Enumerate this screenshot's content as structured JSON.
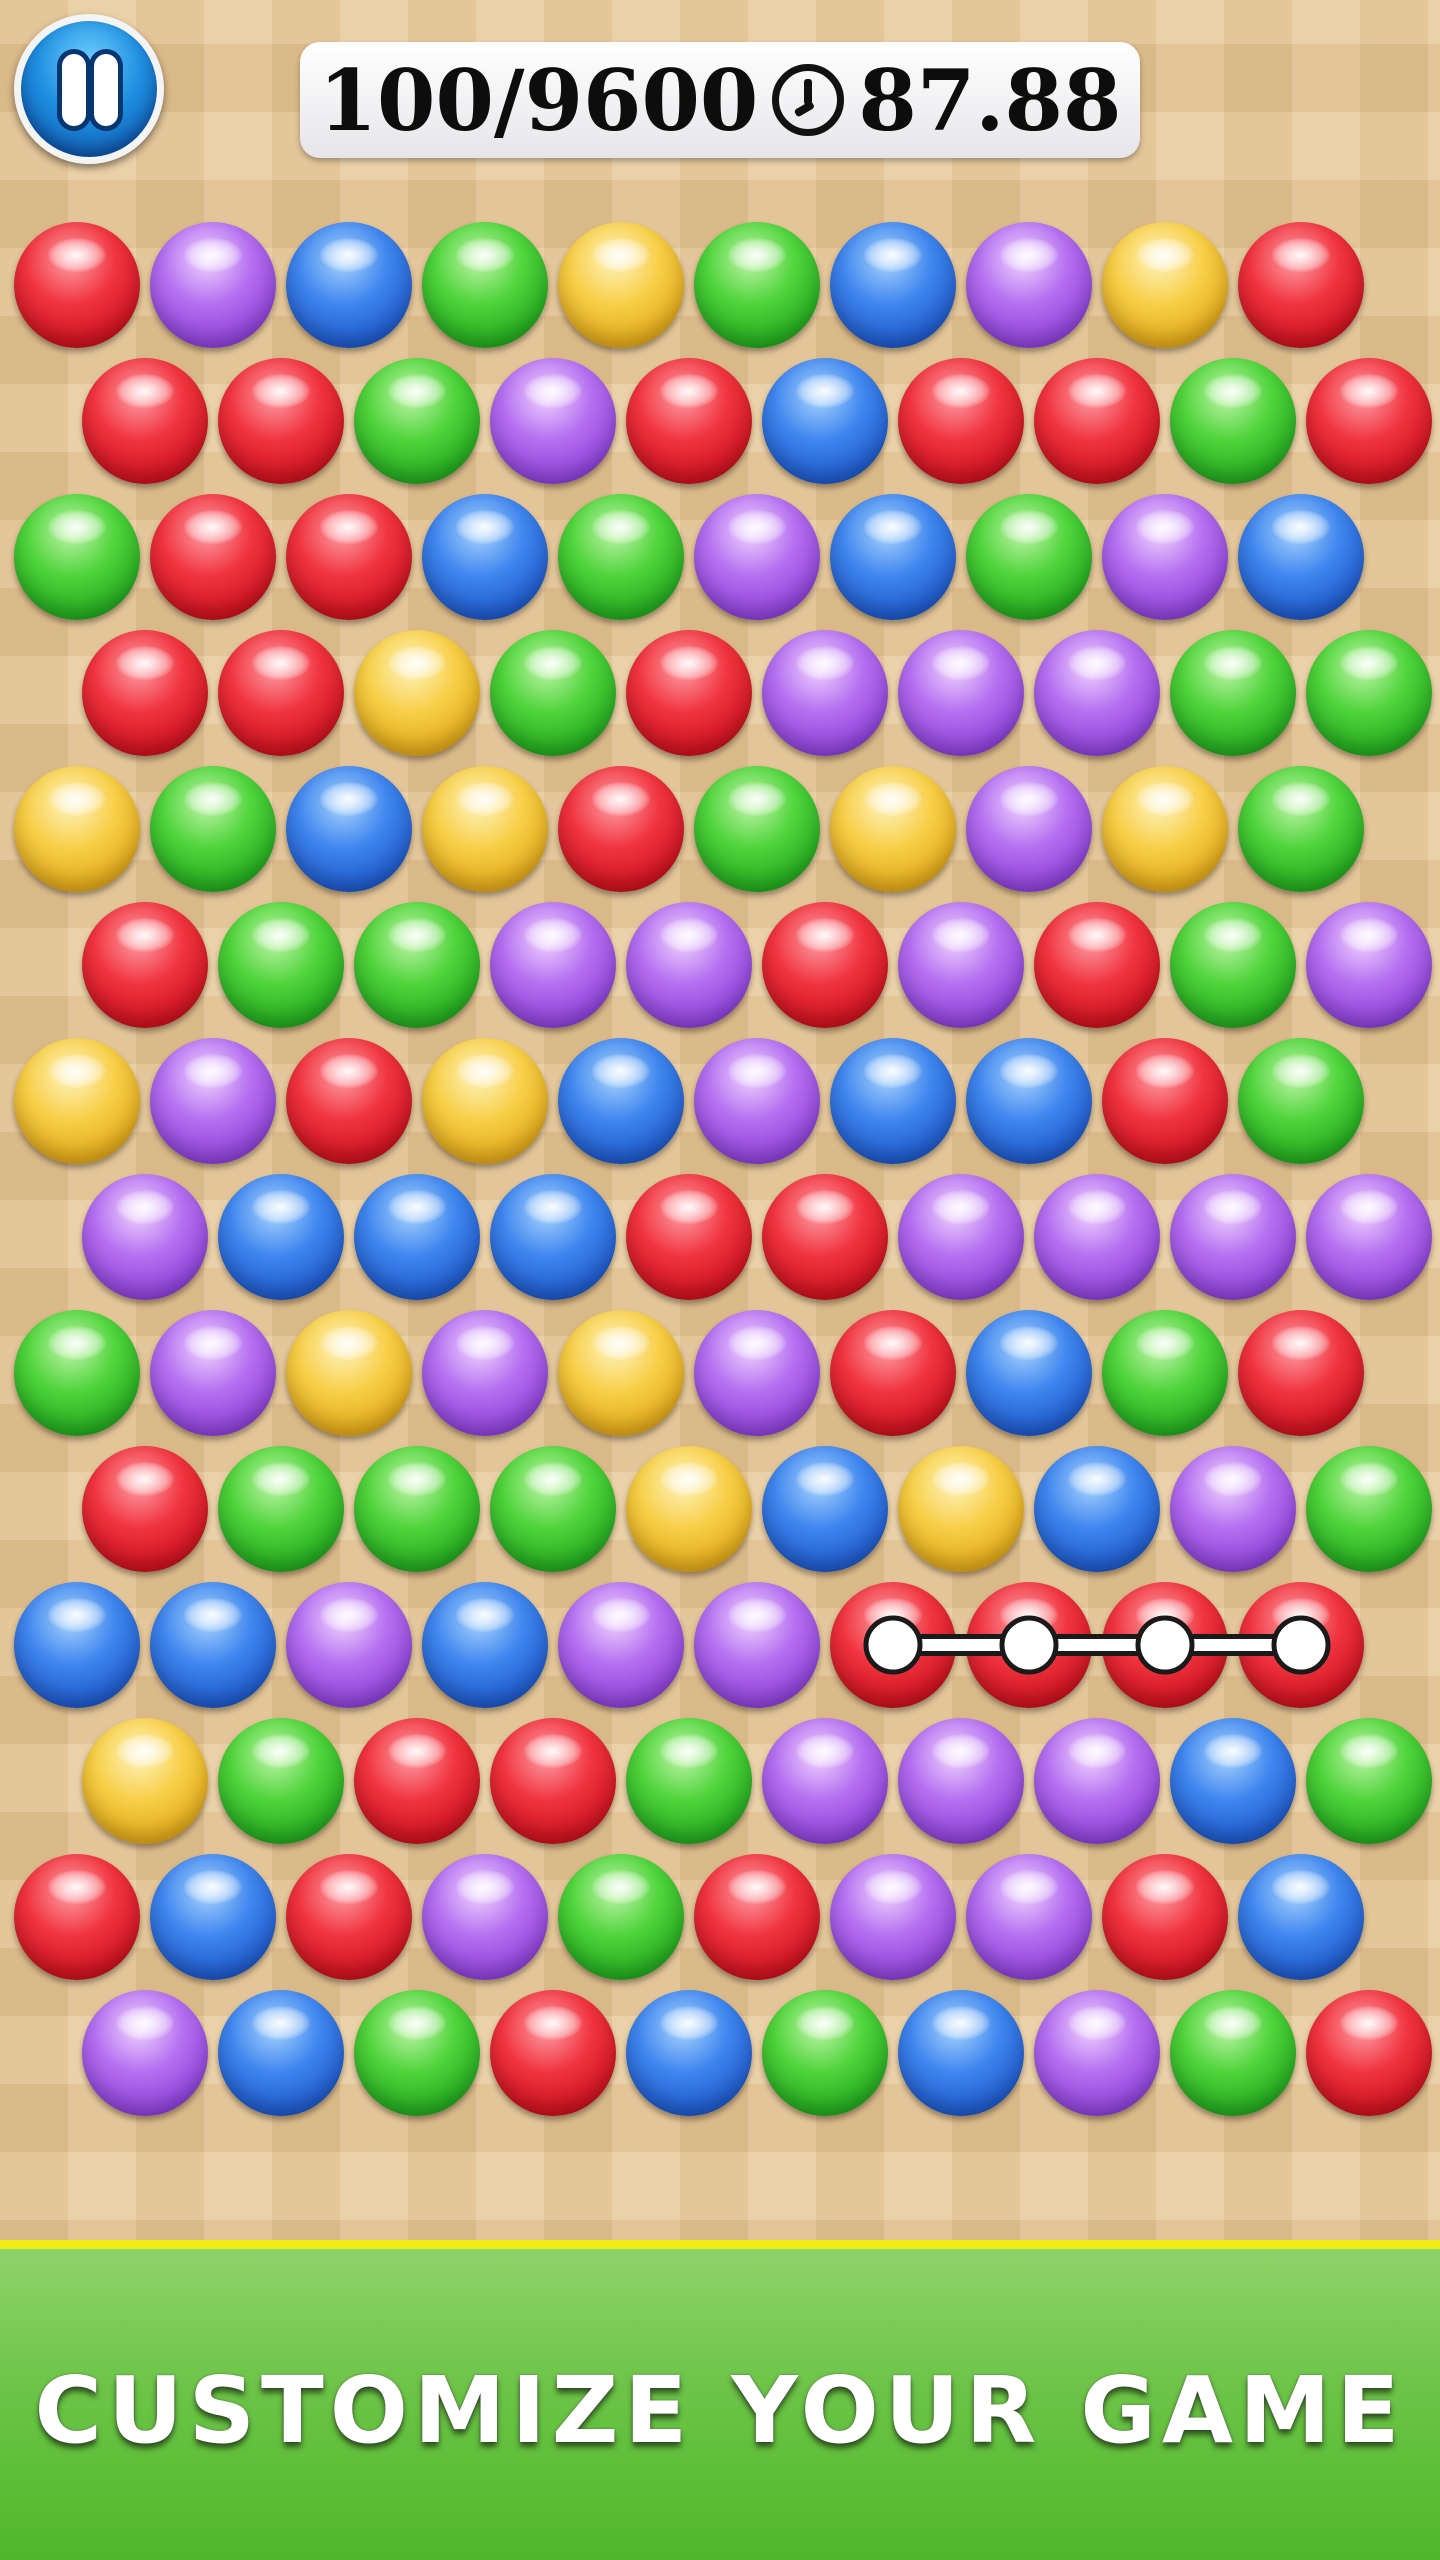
{
  "hud": {
    "pause_icon": "pause-icon",
    "score": "100/9600",
    "clock_icon": "clock-icon",
    "time_left": "87.88"
  },
  "colors": {
    "red": "#e02a35",
    "purple": "#a25ce8",
    "blue": "#2f6fe0",
    "green": "#3cc42f",
    "yellow": "#f0c230",
    "banner": "#5cbf35",
    "banner_border": "#f0ea15"
  },
  "board": {
    "rows": [
      [
        "red",
        "purple",
        "blue",
        "green",
        "yellow",
        "green",
        "blue",
        "purple",
        "yellow",
        "red"
      ],
      [
        "red",
        "red",
        "green",
        "purple",
        "red",
        "blue",
        "red",
        "red",
        "green",
        "red"
      ],
      [
        "green",
        "red",
        "red",
        "blue",
        "green",
        "purple",
        "blue",
        "green",
        "purple",
        "blue"
      ],
      [
        "red",
        "red",
        "yellow",
        "green",
        "red",
        "purple",
        "purple",
        "purple",
        "green",
        "green"
      ],
      [
        "yellow",
        "green",
        "blue",
        "yellow",
        "red",
        "green",
        "yellow",
        "purple",
        "yellow",
        "green"
      ],
      [
        "red",
        "green",
        "green",
        "purple",
        "purple",
        "red",
        "purple",
        "red",
        "green",
        "purple"
      ],
      [
        "yellow",
        "purple",
        "red",
        "yellow",
        "blue",
        "purple",
        "blue",
        "blue",
        "red",
        "green"
      ],
      [
        "purple",
        "blue",
        "blue",
        "blue",
        "red",
        "red",
        "purple",
        "purple",
        "purple",
        "purple"
      ],
      [
        "green",
        "purple",
        "yellow",
        "purple",
        "yellow",
        "purple",
        "red",
        "blue",
        "green",
        "red"
      ],
      [
        "red",
        "green",
        "green",
        "green",
        "yellow",
        "blue",
        "yellow",
        "blue",
        "purple",
        "green"
      ],
      [
        "blue",
        "blue",
        "purple",
        "blue",
        "purple",
        "purple",
        "red",
        "red",
        "red",
        "red"
      ],
      [
        "yellow",
        "green",
        "red",
        "red",
        "green",
        "purple",
        "purple",
        "purple",
        "blue",
        "green"
      ],
      [
        "red",
        "blue",
        "red",
        "purple",
        "green",
        "red",
        "purple",
        "purple",
        "red",
        "blue"
      ],
      [
        "purple",
        "blue",
        "green",
        "red",
        "blue",
        "green",
        "blue",
        "purple",
        "green",
        "red"
      ]
    ],
    "selected_path": [
      [
        10,
        6
      ],
      [
        10,
        7
      ],
      [
        10,
        8
      ],
      [
        10,
        9
      ]
    ]
  },
  "banner": {
    "text": "CUSTOMIZE YOUR GAME"
  }
}
